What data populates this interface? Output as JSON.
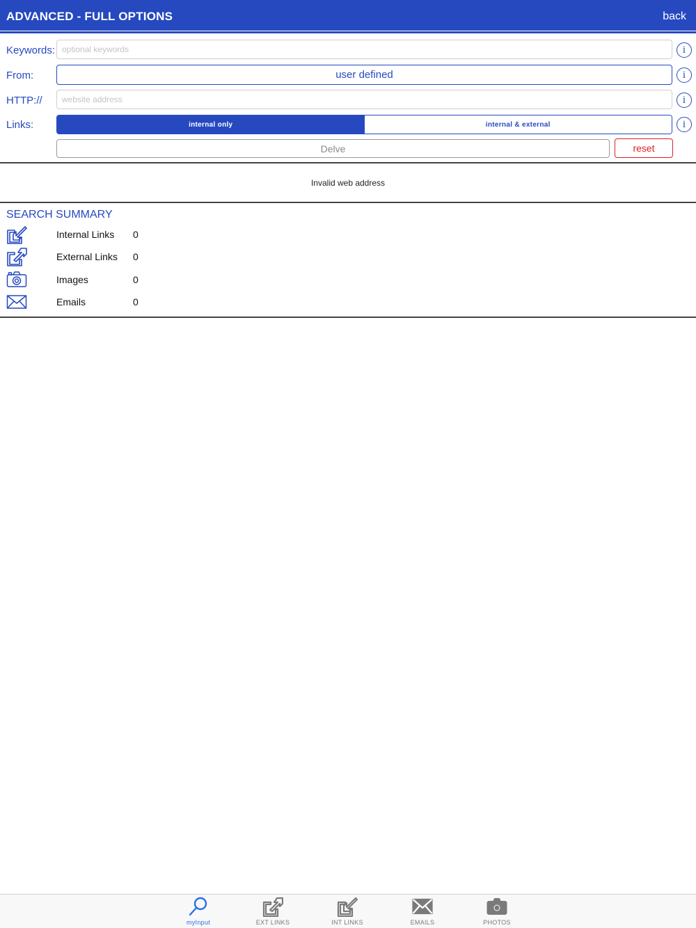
{
  "header": {
    "title": "ADVANCED - FULL OPTIONS",
    "back_label": "back"
  },
  "form": {
    "keywords": {
      "label": "Keywords:",
      "placeholder": "optional keywords",
      "value": ""
    },
    "from": {
      "label": "From:",
      "value": "user defined"
    },
    "http": {
      "label": "HTTP://",
      "placeholder": "website address",
      "value": ""
    },
    "links": {
      "label": "Links:",
      "options": [
        "internal only",
        "internal & external"
      ],
      "selected": "internal only"
    },
    "delve_label": "Delve",
    "reset_label": "reset"
  },
  "status": {
    "message": "Invalid web address"
  },
  "summary": {
    "title": "SEARCH SUMMARY",
    "rows": [
      {
        "icon": "internal-link-icon",
        "label": "Internal Links",
        "value": "0"
      },
      {
        "icon": "external-link-icon",
        "label": "External Links",
        "value": "0"
      },
      {
        "icon": "camera-icon",
        "label": "Images",
        "value": "0"
      },
      {
        "icon": "envelope-icon",
        "label": "Emails",
        "value": "0"
      }
    ]
  },
  "tabs": [
    {
      "label": "myInput",
      "icon": "search-icon",
      "active": true
    },
    {
      "label": "EXT LINKS",
      "icon": "external-link-icon",
      "active": false
    },
    {
      "label": "INT LINKS",
      "icon": "internal-link-icon",
      "active": false
    },
    {
      "label": "EMAILS",
      "icon": "envelope-icon",
      "active": false
    },
    {
      "label": "PHOTOS",
      "icon": "camera-icon",
      "active": false
    }
  ],
  "colors": {
    "accent": "#2649c0",
    "danger": "#e02020",
    "tab_active": "#2a6fe8",
    "tab_inactive": "#7a7a7a"
  }
}
